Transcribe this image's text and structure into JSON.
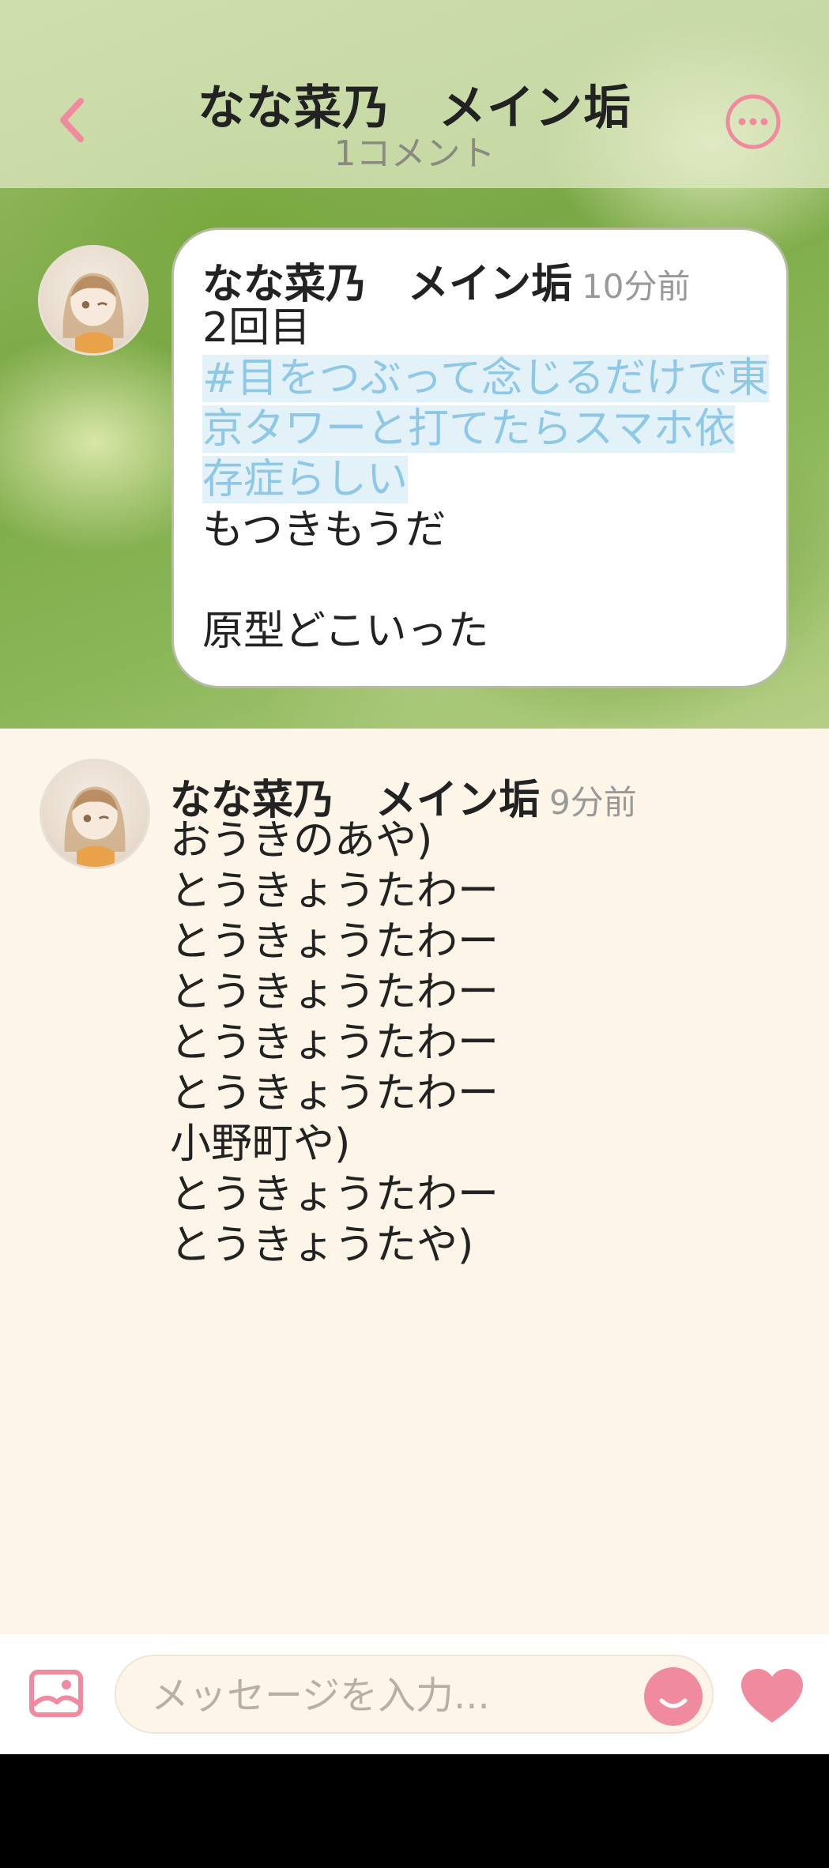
{
  "colors": {
    "accent_pink": "#f08a9e",
    "hashtag_blue": "#8ec8e6",
    "comment_bg": "#fdf6e8"
  },
  "header": {
    "title": "なな菜乃　メイン垢",
    "subtitle": "1コメント",
    "back_icon": "chevron-left-icon",
    "more_icon": "more-horizontal-icon"
  },
  "post": {
    "author": "なな菜乃　メイン垢",
    "time": "10分前",
    "line1": "2回目",
    "hashtag": "#目をつぶって念じるだけで東京タワーと打てたらスマホ依存症らしい",
    "line3": "もつきもうだ",
    "line4": "原型どこいった"
  },
  "comment": {
    "author": "なな菜乃　メイン垢",
    "time": "9分前",
    "lines": [
      "おうきのあや)",
      "とうきょうたわー",
      "とうきょうたわー",
      "とうきょうたわー",
      "とうきょうたわー",
      "とうきょうたわー",
      "小野町や)",
      "とうきょうたわー",
      "とうきょうたや)"
    ]
  },
  "input_bar": {
    "placeholder": "メッセージを入力...",
    "image_icon": "image-icon",
    "emoji_icon": "emoji-smile-icon",
    "heart_icon": "heart-icon"
  }
}
